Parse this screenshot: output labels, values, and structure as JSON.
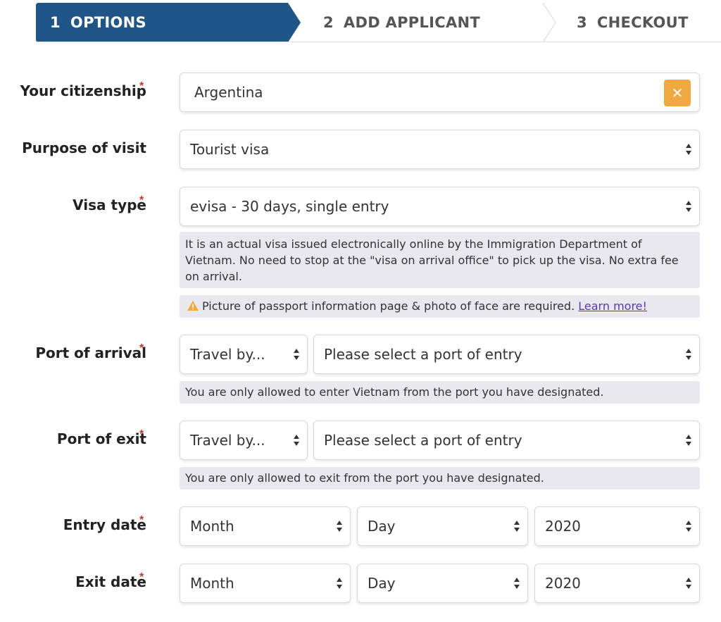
{
  "stepper": {
    "steps": [
      {
        "num": "1",
        "label": "OPTIONS"
      },
      {
        "num": "2",
        "label": "ADD APPLICANT"
      },
      {
        "num": "3",
        "label": "CHECKOUT"
      }
    ],
    "active_color": "#205587"
  },
  "form": {
    "citizenship": {
      "label": "Your citizenship",
      "required": "*",
      "value": "Argentina",
      "clear_icon": "close-icon"
    },
    "purpose": {
      "label": "Purpose of visit",
      "value": "Tourist visa"
    },
    "visa_type": {
      "label": "Visa type",
      "required": "*",
      "value": "evisa - 30 days, single entry",
      "description": "It is an actual visa issued electronically online by the Immigration Department of Vietnam. No need to stop at the \"visa on arrival office\" to pick up the visa. No extra fee on arrival.",
      "warning": "Picture of passport information page & photo of face are required.",
      "learn_more": "Learn more!"
    },
    "port_arrival": {
      "label": "Port of arrival",
      "required": "*",
      "travel_by": "Travel by...",
      "port": "Please select a port of entry",
      "note": "You are only allowed to enter Vietnam from the port you have designated."
    },
    "port_exit": {
      "label": "Port of exit",
      "required": "*",
      "travel_by": "Travel by...",
      "port": "Please select a port of entry",
      "note": "You are only allowed to exit from the port you have designated."
    },
    "entry_date": {
      "label": "Entry date",
      "required": "*",
      "month": "Month",
      "day": "Day",
      "year": "2020"
    },
    "exit_date": {
      "label": "Exit date",
      "required": "*",
      "month": "Month",
      "day": "Day",
      "year": "2020"
    }
  },
  "colors": {
    "required": "#c0392b",
    "clear_button": "#f0a840",
    "note_bg": "#e8e8ee",
    "link": "#5a3aa8",
    "warning": "#f0a840"
  }
}
